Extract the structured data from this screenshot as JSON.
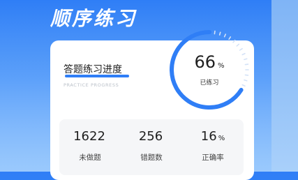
{
  "header": {
    "title": "顺序练习"
  },
  "progress_card": {
    "title": "答题练习进度",
    "subtitle": "PRACTICE PROGRESS",
    "progress": {
      "value": "66",
      "unit": "%",
      "fraction": 0.66,
      "label": "已练习"
    },
    "stats": [
      {
        "value": "1622",
        "unit": "",
        "label": "未做题"
      },
      {
        "value": "256",
        "unit": "",
        "label": "错题数"
      },
      {
        "value": "16",
        "unit": "%",
        "label": "正确率"
      }
    ]
  },
  "colors": {
    "accent": "#2f7ef6",
    "track": "#d4e2f7",
    "card": "#ffffff",
    "stats_bg": "#f5f6f8"
  }
}
